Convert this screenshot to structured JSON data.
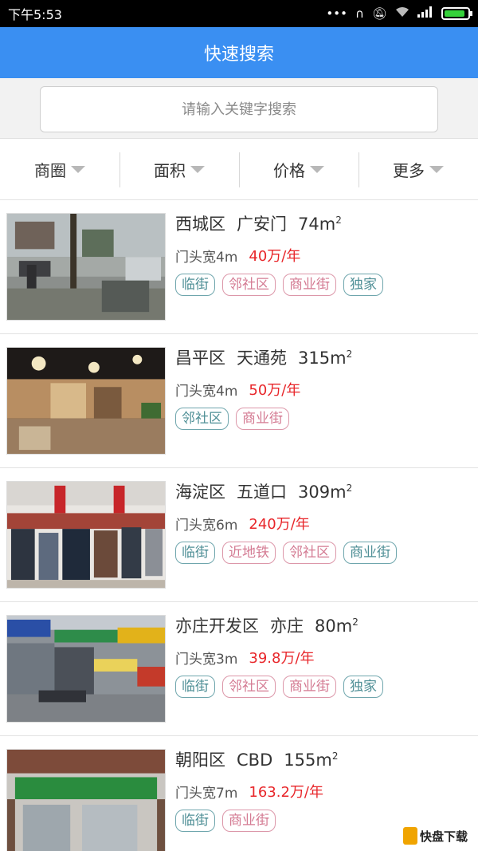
{
  "status_bar": {
    "time": "下午5:53",
    "icons": [
      "more-dots-icon",
      "headphones-icon",
      "mute-icon",
      "wifi-icon",
      "signal-icon",
      "battery-icon"
    ],
    "battery_level": 0.9,
    "battery_color": "#35d13a"
  },
  "header": {
    "title": "快速搜索",
    "background": "#3a8ff2"
  },
  "search": {
    "placeholder": "请输入关键字搜索"
  },
  "filters": [
    {
      "label": "商圈"
    },
    {
      "label": "面积"
    },
    {
      "label": "价格"
    },
    {
      "label": "更多"
    }
  ],
  "area_unit": "m",
  "area_sup": "2",
  "frontage_prefix": "门头宽",
  "listings": [
    {
      "district": "西城区",
      "area_name": "广安门",
      "size": "74",
      "frontage": "4m",
      "price": "40万/年",
      "tags": [
        {
          "text": "临街",
          "color": "teal"
        },
        {
          "text": "邻社区",
          "color": "pink"
        },
        {
          "text": "商业街",
          "color": "pink"
        },
        {
          "text": "独家",
          "color": "teal"
        }
      ]
    },
    {
      "district": "昌平区",
      "area_name": "天通苑",
      "size": "315",
      "frontage": "4m",
      "price": "50万/年",
      "tags": [
        {
          "text": "邻社区",
          "color": "teal"
        },
        {
          "text": "商业街",
          "color": "pink"
        }
      ]
    },
    {
      "district": "海淀区",
      "area_name": "五道口",
      "size": "309",
      "frontage": "6m",
      "price": "240万/年",
      "tags": [
        {
          "text": "临街",
          "color": "teal"
        },
        {
          "text": "近地铁",
          "color": "pink"
        },
        {
          "text": "邻社区",
          "color": "pink"
        },
        {
          "text": "商业街",
          "color": "teal"
        }
      ]
    },
    {
      "district": "亦庄开发区",
      "area_name": "亦庄",
      "size": "80",
      "frontage": "3m",
      "price": "39.8万/年",
      "tags": [
        {
          "text": "临街",
          "color": "teal"
        },
        {
          "text": "邻社区",
          "color": "pink"
        },
        {
          "text": "商业街",
          "color": "pink"
        },
        {
          "text": "独家",
          "color": "teal"
        }
      ]
    },
    {
      "district": "朝阳区",
      "area_name": "CBD",
      "size": "155",
      "frontage": "7m",
      "price": "163.2万/年",
      "tags": [
        {
          "text": "临街",
          "color": "teal"
        },
        {
          "text": "商业街",
          "color": "pink"
        }
      ]
    }
  ],
  "watermark": {
    "text": "快盘下载"
  }
}
